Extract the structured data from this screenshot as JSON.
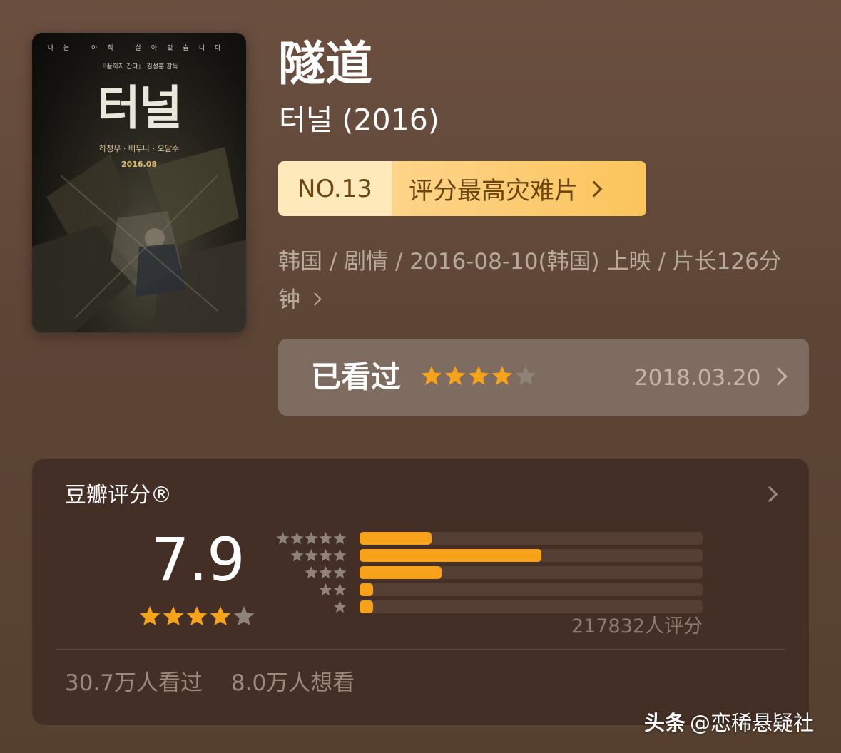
{
  "poster": {
    "tagline": "나는 아직 살아있습니다",
    "credit": "『끝까지 간다』 김성훈 감독",
    "title": "터널",
    "cast": "하정우 · 배두나 · 오달수",
    "date": "2016.08"
  },
  "movie": {
    "title": "隧道",
    "original_title": "터널 (2016)"
  },
  "rank": {
    "number": "NO.13",
    "label": "评分最高灾难片"
  },
  "meta": {
    "line1": "韩国 / 剧情 / 2016-08-10(韩国) 上映 / 片长126分",
    "line2": "钟"
  },
  "watched": {
    "label": "已看过",
    "stars": 4,
    "date": "2018.03.20"
  },
  "rating": {
    "title": "豆瓣评分®",
    "score": "7.9",
    "stars": 4,
    "distribution_percent": [
      21,
      53,
      24,
      4,
      4
    ],
    "count_text": "217832人评分",
    "watched_text": "30.7万人看过",
    "want_text": "8.0万人想看"
  },
  "colors": {
    "accent_star": "#f6a21a",
    "empty_star": "#8f8278",
    "badge_left": "#fde9b9",
    "badge_right": "#fbc45c"
  },
  "watermark": {
    "brand": "头条",
    "handle": "@恋稀悬疑社"
  }
}
